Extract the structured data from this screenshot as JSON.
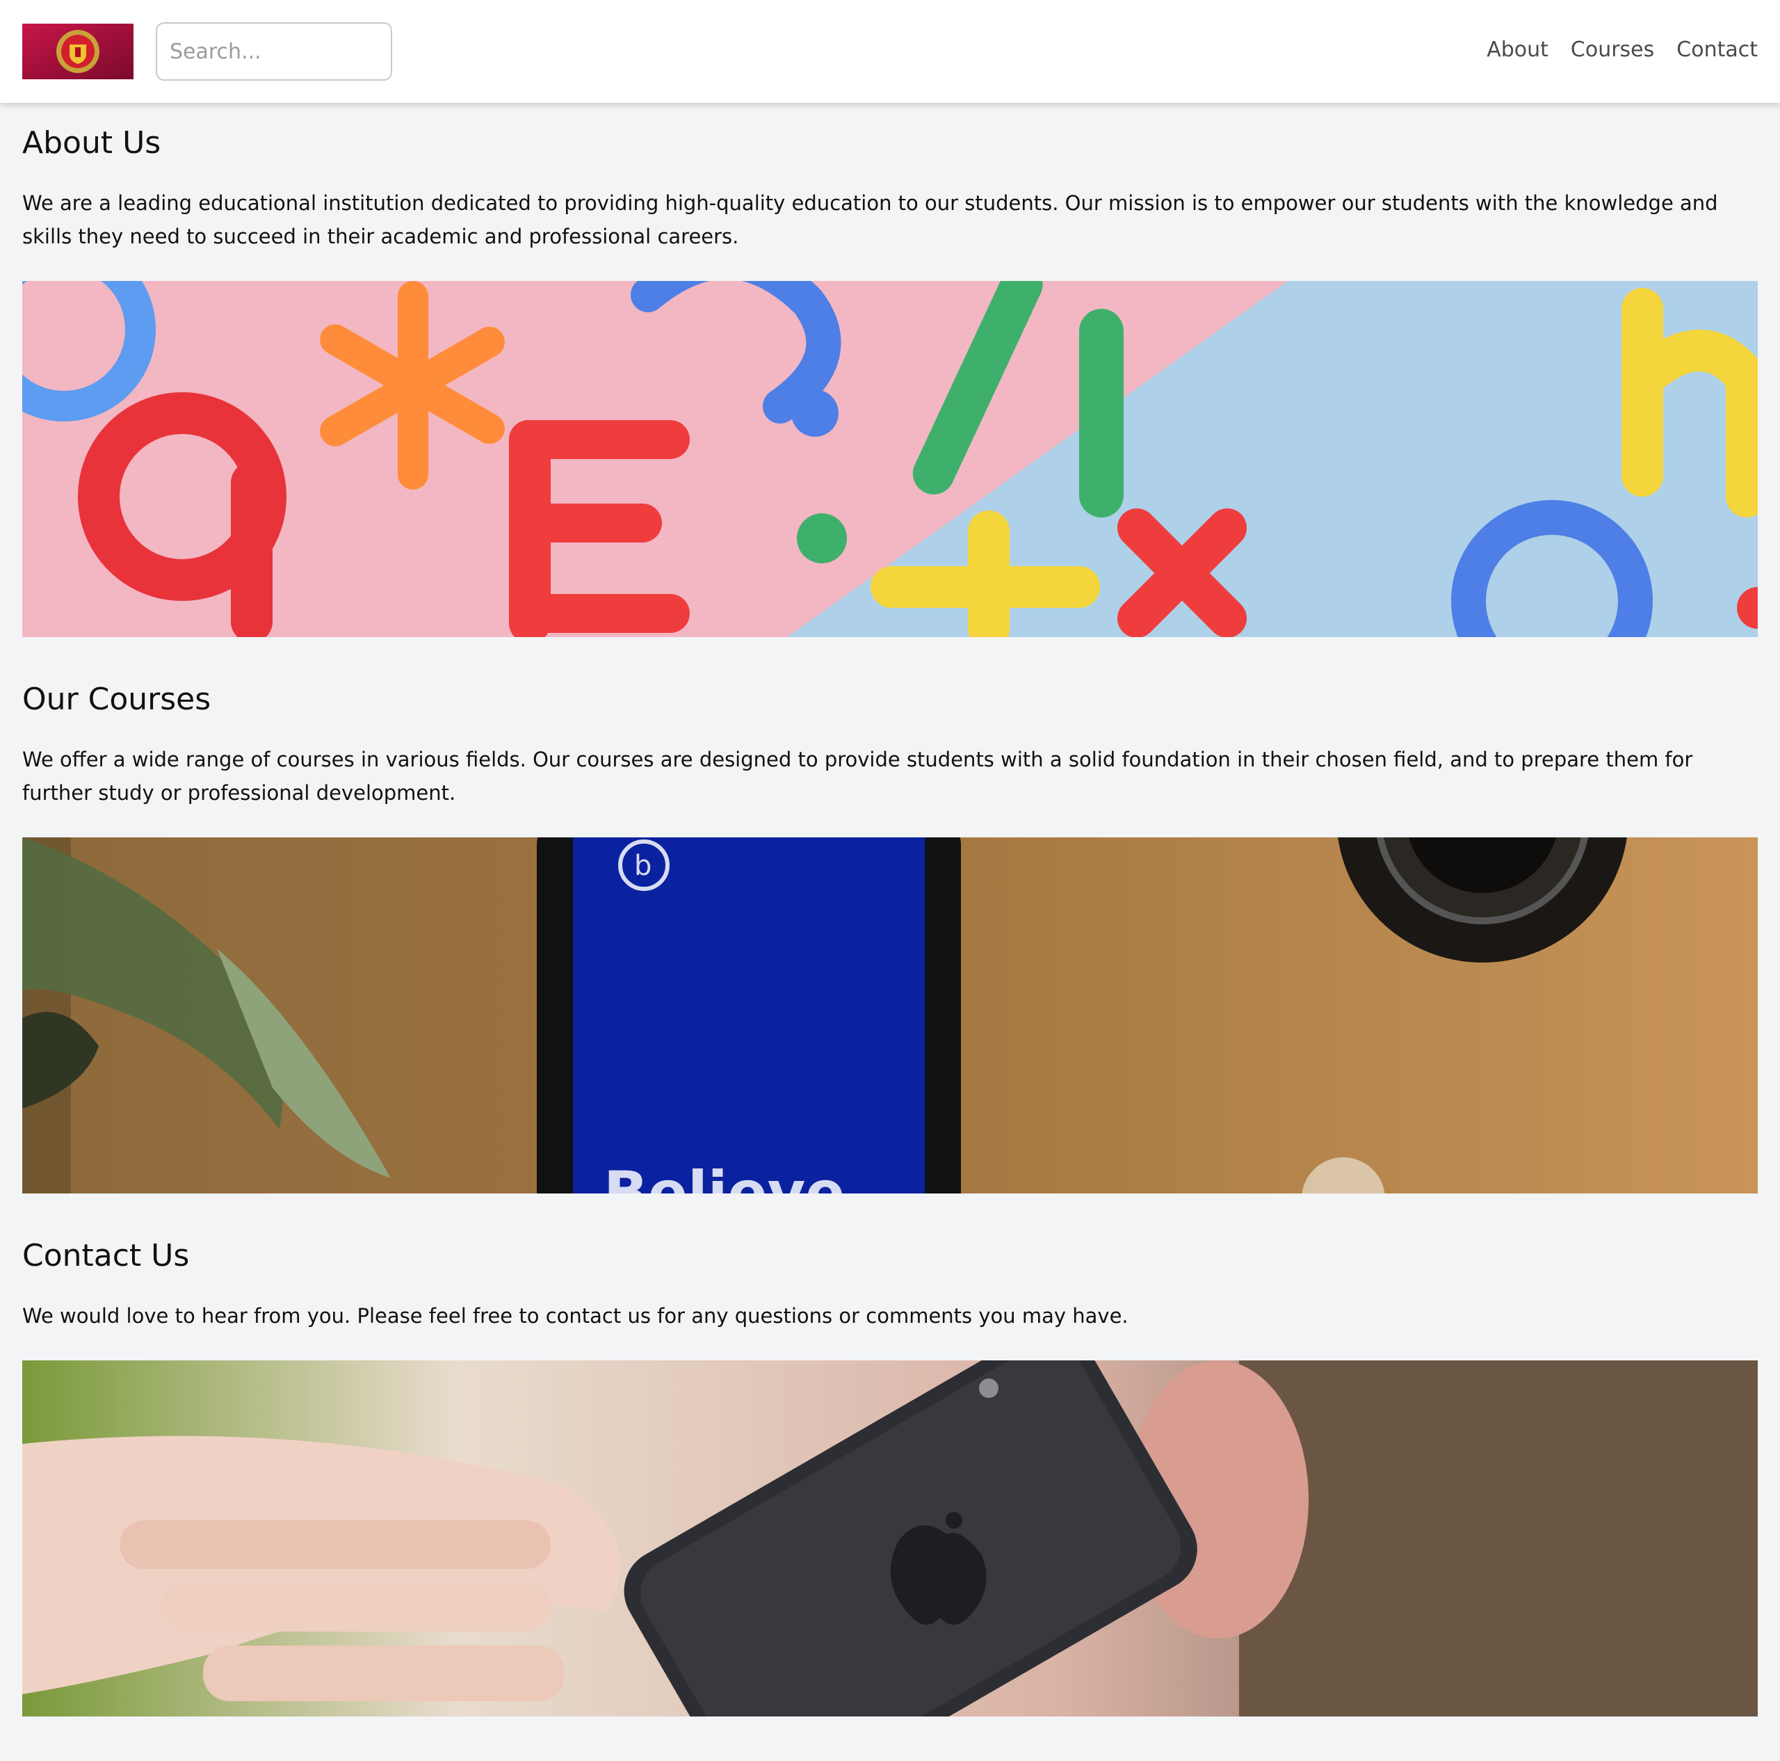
{
  "header": {
    "logo_icon": "club-crest-logo",
    "search": {
      "placeholder": "Search...",
      "value": ""
    },
    "nav": [
      {
        "label": "About"
      },
      {
        "label": "Courses"
      },
      {
        "label": "Contact"
      }
    ]
  },
  "sections": [
    {
      "title": "About Us",
      "text": "We are a leading educational institution dedicated to providing high-quality education to our students. Our mission is to empower our students with the knowledge and skills they need to succeed in their academic and professional careers.",
      "image": "colorful-plastic-letters-photo"
    },
    {
      "title": "Our Courses",
      "text": "We offer a wide range of courses in various fields. Our courses are designed to provide students with a solid foundation in their chosen field, and to prepare them for further study or professional development.",
      "image": "phone-on-wooden-desk-photo",
      "image_text": "Believe"
    },
    {
      "title": "Contact Us",
      "text": "We would love to hear from you. Please feel free to contact us for any questions or comments you may have.",
      "image": "person-on-phone-call-photo"
    }
  ],
  "colors": {
    "background": "#f3f4f6",
    "header_background": "#ffffff",
    "nav_text": "#4b4b4b",
    "logo_red": "#b0103c"
  }
}
